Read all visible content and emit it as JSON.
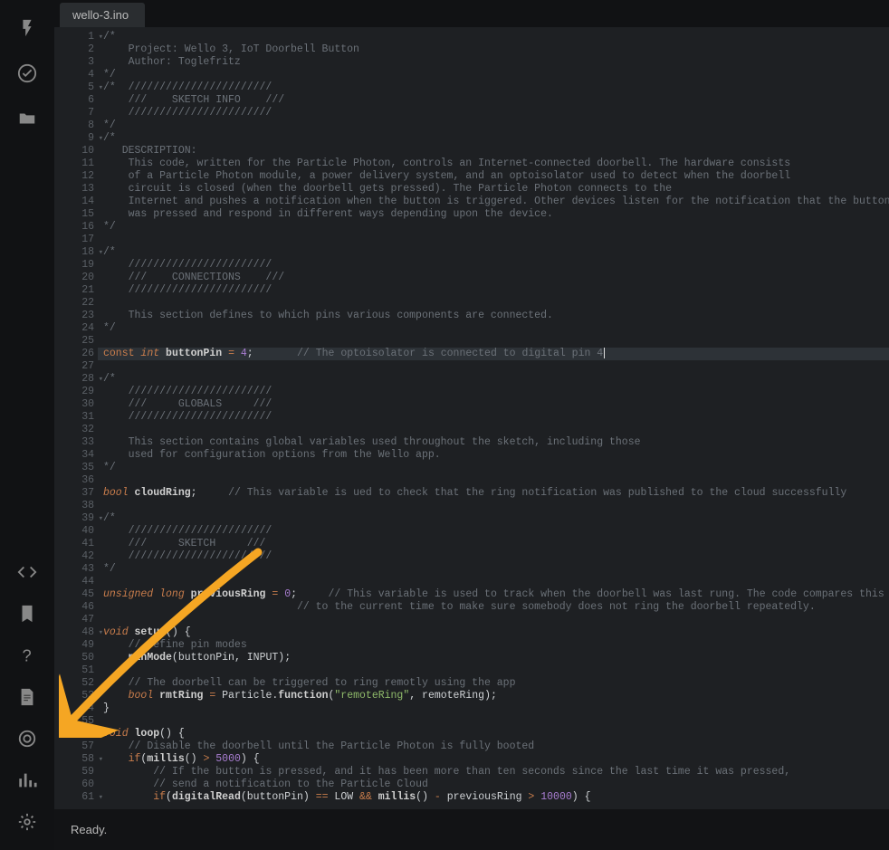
{
  "tab": {
    "filename": "wello-3.ino"
  },
  "status": {
    "text": "Ready."
  },
  "sidebar": {
    "top": [
      "flash-icon",
      "verify-icon",
      "folder-icon"
    ],
    "bottom": [
      "code-icon",
      "bookmark-icon",
      "help-icon",
      "docs-icon",
      "target-icon",
      "graph-icon",
      "settings-icon"
    ]
  },
  "highlight_line": 26,
  "fold_lines": [
    1,
    5,
    9,
    18,
    28,
    39,
    48,
    56,
    58,
    61
  ],
  "code": [
    {
      "n": 1,
      "tokens": [
        [
          "comment",
          "/*"
        ]
      ]
    },
    {
      "n": 2,
      "tokens": [
        [
          "comment",
          "    Project: Wello 3, IoT Doorbell Button"
        ]
      ]
    },
    {
      "n": 3,
      "tokens": [
        [
          "comment",
          "    Author: Toglefritz"
        ]
      ]
    },
    {
      "n": 4,
      "tokens": [
        [
          "comment",
          "*/"
        ]
      ]
    },
    {
      "n": 5,
      "tokens": [
        [
          "comment",
          "/*  ///////////////////////"
        ]
      ]
    },
    {
      "n": 6,
      "tokens": [
        [
          "comment",
          "    ///    SKETCH INFO    ///"
        ]
      ]
    },
    {
      "n": 7,
      "tokens": [
        [
          "comment",
          "    ///////////////////////"
        ]
      ]
    },
    {
      "n": 8,
      "tokens": [
        [
          "comment",
          "*/"
        ]
      ]
    },
    {
      "n": 9,
      "tokens": [
        [
          "comment",
          "/*"
        ]
      ]
    },
    {
      "n": 10,
      "tokens": [
        [
          "comment",
          "   DESCRIPTION:"
        ]
      ]
    },
    {
      "n": 11,
      "tokens": [
        [
          "comment",
          "    This code, written for the Particle Photon, controls an Internet-connected doorbell. The hardware consists"
        ]
      ]
    },
    {
      "n": 12,
      "tokens": [
        [
          "comment",
          "    of a Particle Photon module, a power delivery system, and an optoisolator used to detect when the doorbell"
        ]
      ]
    },
    {
      "n": 13,
      "tokens": [
        [
          "comment",
          "    circuit is closed (when the doorbell gets pressed). The Particle Photon connects to the"
        ]
      ]
    },
    {
      "n": 14,
      "tokens": [
        [
          "comment",
          "    Internet and pushes a notification when the button is triggered. Other devices listen for the notification that the button"
        ]
      ]
    },
    {
      "n": 15,
      "tokens": [
        [
          "comment",
          "    was pressed and respond in different ways depending upon the device."
        ]
      ]
    },
    {
      "n": 16,
      "tokens": [
        [
          "comment",
          "*/"
        ]
      ]
    },
    {
      "n": 17,
      "tokens": [
        [
          "text",
          ""
        ]
      ]
    },
    {
      "n": 18,
      "tokens": [
        [
          "comment",
          "/*"
        ]
      ]
    },
    {
      "n": 19,
      "tokens": [
        [
          "comment",
          "    ///////////////////////"
        ]
      ]
    },
    {
      "n": 20,
      "tokens": [
        [
          "comment",
          "    ///    CONNECTIONS    ///"
        ]
      ]
    },
    {
      "n": 21,
      "tokens": [
        [
          "comment",
          "    ///////////////////////"
        ]
      ]
    },
    {
      "n": 22,
      "tokens": [
        [
          "text",
          ""
        ]
      ]
    },
    {
      "n": 23,
      "tokens": [
        [
          "comment",
          "    This section defines to which pins various components are connected."
        ]
      ]
    },
    {
      "n": 24,
      "tokens": [
        [
          "comment",
          "*/"
        ]
      ]
    },
    {
      "n": 25,
      "tokens": [
        [
          "text",
          ""
        ]
      ]
    },
    {
      "n": 26,
      "tokens": [
        [
          "keyword",
          "const"
        ],
        [
          "text",
          " "
        ],
        [
          "type",
          "int"
        ],
        [
          "text",
          " "
        ],
        [
          "ident",
          "buttonPin"
        ],
        [
          "text",
          " "
        ],
        [
          "op",
          "="
        ],
        [
          "text",
          " "
        ],
        [
          "num",
          "4"
        ],
        [
          "punct",
          ";"
        ],
        [
          "text",
          "       "
        ],
        [
          "comment",
          "// The optoisolator is connected to digital pin 4"
        ]
      ],
      "cursor": true
    },
    {
      "n": 27,
      "tokens": [
        [
          "text",
          ""
        ]
      ]
    },
    {
      "n": 28,
      "tokens": [
        [
          "comment",
          "/*"
        ]
      ]
    },
    {
      "n": 29,
      "tokens": [
        [
          "comment",
          "    ///////////////////////"
        ]
      ]
    },
    {
      "n": 30,
      "tokens": [
        [
          "comment",
          "    ///     GLOBALS     ///"
        ]
      ]
    },
    {
      "n": 31,
      "tokens": [
        [
          "comment",
          "    ///////////////////////"
        ]
      ]
    },
    {
      "n": 32,
      "tokens": [
        [
          "text",
          ""
        ]
      ]
    },
    {
      "n": 33,
      "tokens": [
        [
          "comment",
          "    This section contains global variables used throughout the sketch, including those"
        ]
      ]
    },
    {
      "n": 34,
      "tokens": [
        [
          "comment",
          "    used for configuration options from the Wello app."
        ]
      ]
    },
    {
      "n": 35,
      "tokens": [
        [
          "comment",
          "*/"
        ]
      ]
    },
    {
      "n": 36,
      "tokens": [
        [
          "text",
          ""
        ]
      ]
    },
    {
      "n": 37,
      "tokens": [
        [
          "type",
          "bool"
        ],
        [
          "text",
          " "
        ],
        [
          "ident",
          "cloudRing"
        ],
        [
          "punct",
          ";"
        ],
        [
          "text",
          "     "
        ],
        [
          "comment",
          "// This variable is ued to check that the ring notification was published to the cloud successfully"
        ]
      ]
    },
    {
      "n": 38,
      "tokens": [
        [
          "text",
          ""
        ]
      ]
    },
    {
      "n": 39,
      "tokens": [
        [
          "comment",
          "/*"
        ]
      ]
    },
    {
      "n": 40,
      "tokens": [
        [
          "comment",
          "    ///////////////////////"
        ]
      ]
    },
    {
      "n": 41,
      "tokens": [
        [
          "comment",
          "    ///     SKETCH     ///"
        ]
      ]
    },
    {
      "n": 42,
      "tokens": [
        [
          "comment",
          "    ///////////////////////"
        ]
      ]
    },
    {
      "n": 43,
      "tokens": [
        [
          "comment",
          "*/"
        ]
      ]
    },
    {
      "n": 44,
      "tokens": [
        [
          "text",
          ""
        ]
      ]
    },
    {
      "n": 45,
      "tokens": [
        [
          "type",
          "unsigned"
        ],
        [
          "text",
          " "
        ],
        [
          "type",
          "long"
        ],
        [
          "text",
          " "
        ],
        [
          "ident",
          "previousRing"
        ],
        [
          "text",
          " "
        ],
        [
          "op",
          "="
        ],
        [
          "text",
          " "
        ],
        [
          "num",
          "0"
        ],
        [
          "punct",
          ";"
        ],
        [
          "text",
          "     "
        ],
        [
          "comment",
          "// This variable is used to track when the doorbell was last rung. The code compares this time"
        ]
      ]
    },
    {
      "n": 46,
      "tokens": [
        [
          "text",
          "                               "
        ],
        [
          "comment",
          "// to the current time to make sure somebody does not ring the doorbell repeatedly."
        ]
      ]
    },
    {
      "n": 47,
      "tokens": [
        [
          "text",
          ""
        ]
      ]
    },
    {
      "n": 48,
      "tokens": [
        [
          "type",
          "void"
        ],
        [
          "text",
          " "
        ],
        [
          "func",
          "setup"
        ],
        [
          "punct",
          "()"
        ],
        [
          "text",
          " "
        ],
        [
          "punct",
          "{"
        ]
      ]
    },
    {
      "n": 49,
      "tokens": [
        [
          "text",
          "    "
        ],
        [
          "comment",
          "// Define pin modes"
        ]
      ]
    },
    {
      "n": 50,
      "tokens": [
        [
          "text",
          "    "
        ],
        [
          "func",
          "pinMode"
        ],
        [
          "punct",
          "("
        ],
        [
          "text",
          "buttonPin"
        ],
        [
          "punct",
          ","
        ],
        [
          "text",
          " INPUT"
        ],
        [
          "punct",
          ")"
        ],
        [
          "punct",
          ";"
        ]
      ]
    },
    {
      "n": 51,
      "tokens": [
        [
          "text",
          ""
        ]
      ]
    },
    {
      "n": 52,
      "tokens": [
        [
          "text",
          "    "
        ],
        [
          "comment",
          "// The doorbell can be triggered to ring remotly using the app"
        ]
      ]
    },
    {
      "n": 53,
      "tokens": [
        [
          "text",
          "    "
        ],
        [
          "type",
          "bool"
        ],
        [
          "text",
          " "
        ],
        [
          "ident",
          "rmtRing"
        ],
        [
          "text",
          " "
        ],
        [
          "op",
          "="
        ],
        [
          "text",
          " Particle"
        ],
        [
          "punct",
          "."
        ],
        [
          "func",
          "function"
        ],
        [
          "punct",
          "("
        ],
        [
          "str",
          "\"remoteRing\""
        ],
        [
          "punct",
          ","
        ],
        [
          "text",
          " remoteRing"
        ],
        [
          "punct",
          ")"
        ],
        [
          "punct",
          ";"
        ]
      ]
    },
    {
      "n": 54,
      "tokens": [
        [
          "punct",
          "}"
        ]
      ]
    },
    {
      "n": 55,
      "tokens": [
        [
          "text",
          ""
        ]
      ]
    },
    {
      "n": 56,
      "tokens": [
        [
          "type",
          "void"
        ],
        [
          "text",
          " "
        ],
        [
          "func",
          "loop"
        ],
        [
          "punct",
          "()"
        ],
        [
          "text",
          " "
        ],
        [
          "punct",
          "{"
        ]
      ]
    },
    {
      "n": 57,
      "tokens": [
        [
          "text",
          "    "
        ],
        [
          "comment",
          "// Disable the doorbell until the Particle Photon is fully booted"
        ]
      ]
    },
    {
      "n": 58,
      "tokens": [
        [
          "text",
          "    "
        ],
        [
          "keyword",
          "if"
        ],
        [
          "punct",
          "("
        ],
        [
          "func",
          "millis"
        ],
        [
          "punct",
          "()"
        ],
        [
          "text",
          " "
        ],
        [
          "op",
          ">"
        ],
        [
          "text",
          " "
        ],
        [
          "num",
          "5000"
        ],
        [
          "punct",
          ")"
        ],
        [
          "text",
          " "
        ],
        [
          "punct",
          "{"
        ]
      ]
    },
    {
      "n": 59,
      "tokens": [
        [
          "text",
          "        "
        ],
        [
          "comment",
          "// If the button is pressed, and it has been more than ten seconds since the last time it was pressed,"
        ]
      ]
    },
    {
      "n": 60,
      "tokens": [
        [
          "text",
          "        "
        ],
        [
          "comment",
          "// send a notification to the Particle Cloud"
        ]
      ]
    },
    {
      "n": 61,
      "tokens": [
        [
          "text",
          "        "
        ],
        [
          "keyword",
          "if"
        ],
        [
          "punct",
          "("
        ],
        [
          "func",
          "digitalRead"
        ],
        [
          "punct",
          "("
        ],
        [
          "text",
          "buttonPin"
        ],
        [
          "punct",
          ")"
        ],
        [
          "text",
          " "
        ],
        [
          "op",
          "=="
        ],
        [
          "text",
          " LOW "
        ],
        [
          "op",
          "&&"
        ],
        [
          "text",
          " "
        ],
        [
          "func",
          "millis"
        ],
        [
          "punct",
          "()"
        ],
        [
          "text",
          " "
        ],
        [
          "op",
          "-"
        ],
        [
          "text",
          " previousRing "
        ],
        [
          "op",
          ">"
        ],
        [
          "text",
          " "
        ],
        [
          "num",
          "10000"
        ],
        [
          "punct",
          ")"
        ],
        [
          "text",
          " "
        ],
        [
          "punct",
          "{"
        ]
      ]
    }
  ]
}
